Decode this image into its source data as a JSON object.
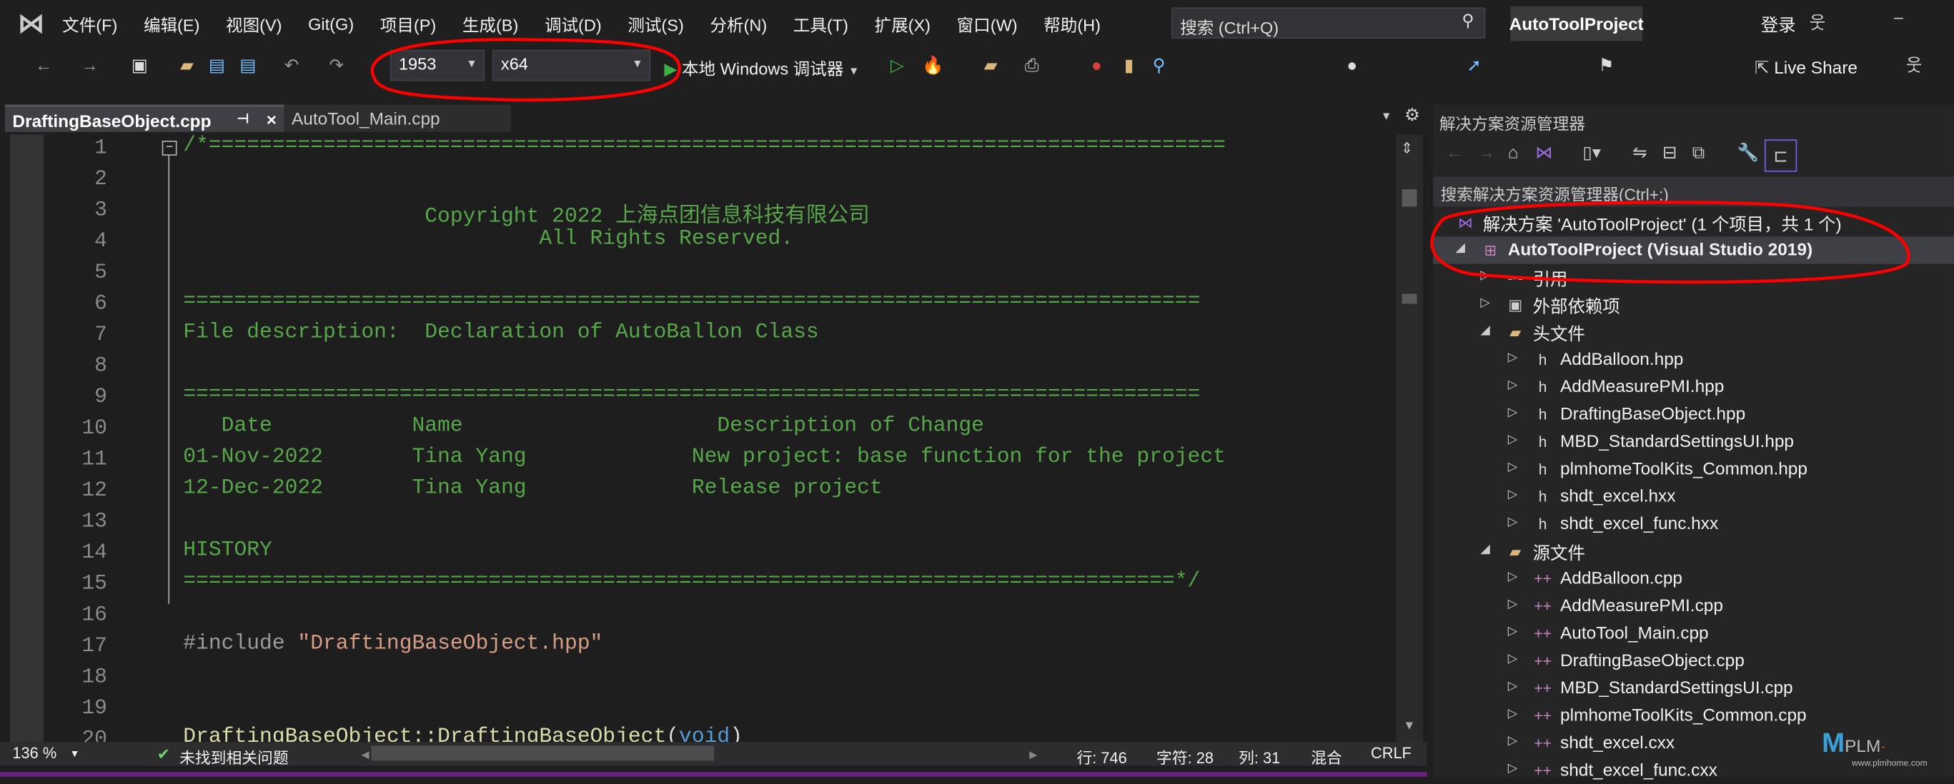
{
  "menu": {
    "items": [
      "文件(F)",
      "编辑(E)",
      "视图(V)",
      "Git(G)",
      "项目(P)",
      "生成(B)",
      "调试(D)",
      "测试(S)",
      "分析(N)",
      "工具(T)",
      "扩展(X)",
      "窗口(W)",
      "帮助(H)"
    ]
  },
  "search": {
    "placeholder": "搜索 (Ctrl+Q)"
  },
  "title": "AutoToolProject",
  "account": {
    "signin": "登录"
  },
  "toolbar": {
    "configuration": "1953",
    "platform": "x64",
    "debugger": "本地 Windows 调试器",
    "live_share": "Live Share"
  },
  "tabs": [
    {
      "label": "DraftingBaseObject.cpp",
      "active": true
    },
    {
      "label": "AutoTool_Main.cpp",
      "active": false
    }
  ],
  "editor": {
    "line_numbers": [
      "1",
      "2",
      "3",
      "4",
      "5",
      "6",
      "7",
      "8",
      "9",
      "10",
      "11",
      "12",
      "13",
      "14",
      "15",
      "16",
      "17",
      "18",
      "19",
      "20"
    ],
    "lines": [
      "/*================================================================================",
      "",
      "                   Copyright 2022 上海点团信息科技有限公司",
      "                            All Rights Reserved.",
      "",
      "================================================================================",
      "File description:  Declaration of AutoBallon Class",
      "",
      "================================================================================",
      "   Date           Name                    Description of Change",
      "01-Nov-2022       Tina Yang             New project: base function for the project",
      "12-Dec-2022       Tina Yang             Release project",
      "",
      "HISTORY",
      "==============================================================================*/",
      "",
      "",
      "",
      "",
      ""
    ],
    "include_directive": "#include",
    "include_file": "\"DraftingBaseObject.hpp\"",
    "line20_name": "DraftingBaseObject::DraftingBaseObject",
    "line20_paren_open": "(",
    "line20_keyword": "void",
    "line20_paren_close": ")"
  },
  "status": {
    "zoom": "136 %",
    "issues": "未找到相关问题",
    "line": "行: 746",
    "char": "字符: 28",
    "col": "列: 31",
    "tabs": "混合",
    "eol": "CRLF"
  },
  "solution_explorer": {
    "title": "解决方案资源管理器",
    "search_placeholder": "搜索解决方案资源管理器(Ctrl+;)",
    "solution": "解决方案 'AutoToolProject' (1 个项目，共 1 个)",
    "project": "AutoToolProject (Visual Studio 2019)",
    "references": "引用",
    "external": "外部依赖项",
    "headers_folder": "头文件",
    "headers": [
      "AddBalloon.hpp",
      "AddMeasurePMI.hpp",
      "DraftingBaseObject.hpp",
      "MBD_StandardSettingsUI.hpp",
      "plmhomeToolKits_Common.hpp",
      "shdt_excel.hxx",
      "shdt_excel_func.hxx"
    ],
    "sources_folder": "源文件",
    "sources": [
      "AddBalloon.cpp",
      "AddMeasurePMI.cpp",
      "AutoTool_Main.cpp",
      "DraftingBaseObject.cpp",
      "MBD_StandardSettingsUI.cpp",
      "plmhomeToolKits_Common.cpp",
      "shdt_excel.cxx",
      "shdt_excel_func.cxx"
    ]
  },
  "watermark": {
    "logo": "PLM",
    "url": "www.plmhome.com"
  },
  "colors": {
    "comment": "#57a64a",
    "accent": "#68217a",
    "annotation": "#ff0000",
    "string": "#d69d85",
    "function": "#dcdcaa",
    "keyword": "#569cd6"
  }
}
